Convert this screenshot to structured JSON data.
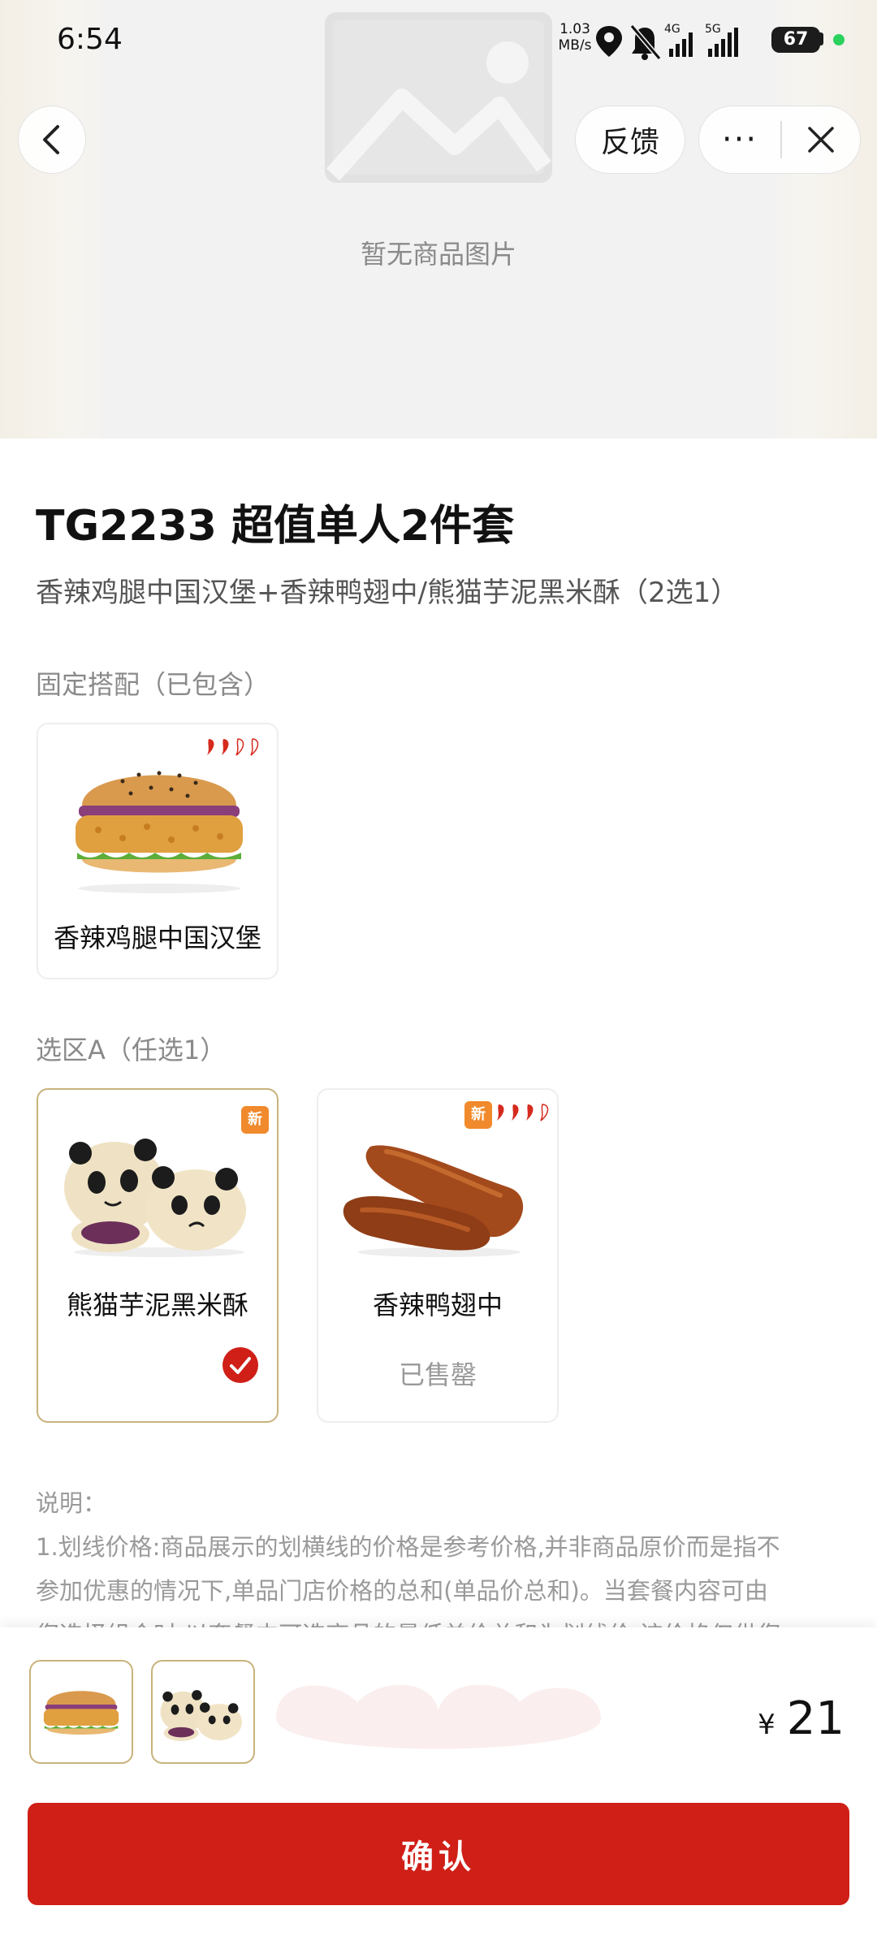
{
  "status_bar": {
    "time": "6:54",
    "net_speed_value": "1.03",
    "net_speed_unit": "MB/s",
    "battery": "67",
    "signal_1": "4G",
    "signal_2": "5G"
  },
  "hero": {
    "no_image_text": "暂无商品图片"
  },
  "nav": {
    "feedback_label": "反馈",
    "more_label": "···"
  },
  "product": {
    "title": "TG2233 超值单人2件套",
    "subtitle": "香辣鸡腿中国汉堡+香辣鸭翅中/熊猫芋泥黑米酥（2选1）"
  },
  "fixed_section": {
    "label": "固定搭配（已包含）",
    "items": [
      {
        "name": "香辣鸡腿中国汉堡",
        "spice_level": 2,
        "icon": "burger-image"
      }
    ]
  },
  "section_a": {
    "label": "选区A（任选1）",
    "items": [
      {
        "name": "熊猫芋泥黑米酥",
        "selected": true,
        "is_new": true,
        "icon": "panda-pastry-image"
      },
      {
        "name": "香辣鸭翅中",
        "selected": false,
        "is_new": true,
        "spice_level": 3,
        "status": "已售罄",
        "icon": "duck-wing-image"
      }
    ]
  },
  "notes": {
    "heading": "说明：",
    "line_1": "1.划线价格:商品展示的划横线的价格是参考价格,并非商品原价而是指不",
    "line_2": "参加优惠的情况下,单品门店价格的总和(单品价总和)。当套餐内容可由",
    "line_3": "您选择组合时,以套餐内可选商品的最低单价总和为划线价,该价格仅供您"
  },
  "bottom": {
    "currency": "¥",
    "price": "21",
    "confirm_label": "确认"
  },
  "colors": {
    "accent_red": "#cf1f17",
    "selected_border": "#c9b27c",
    "new_badge": "#f08a2c"
  },
  "new_badge_text": "新"
}
